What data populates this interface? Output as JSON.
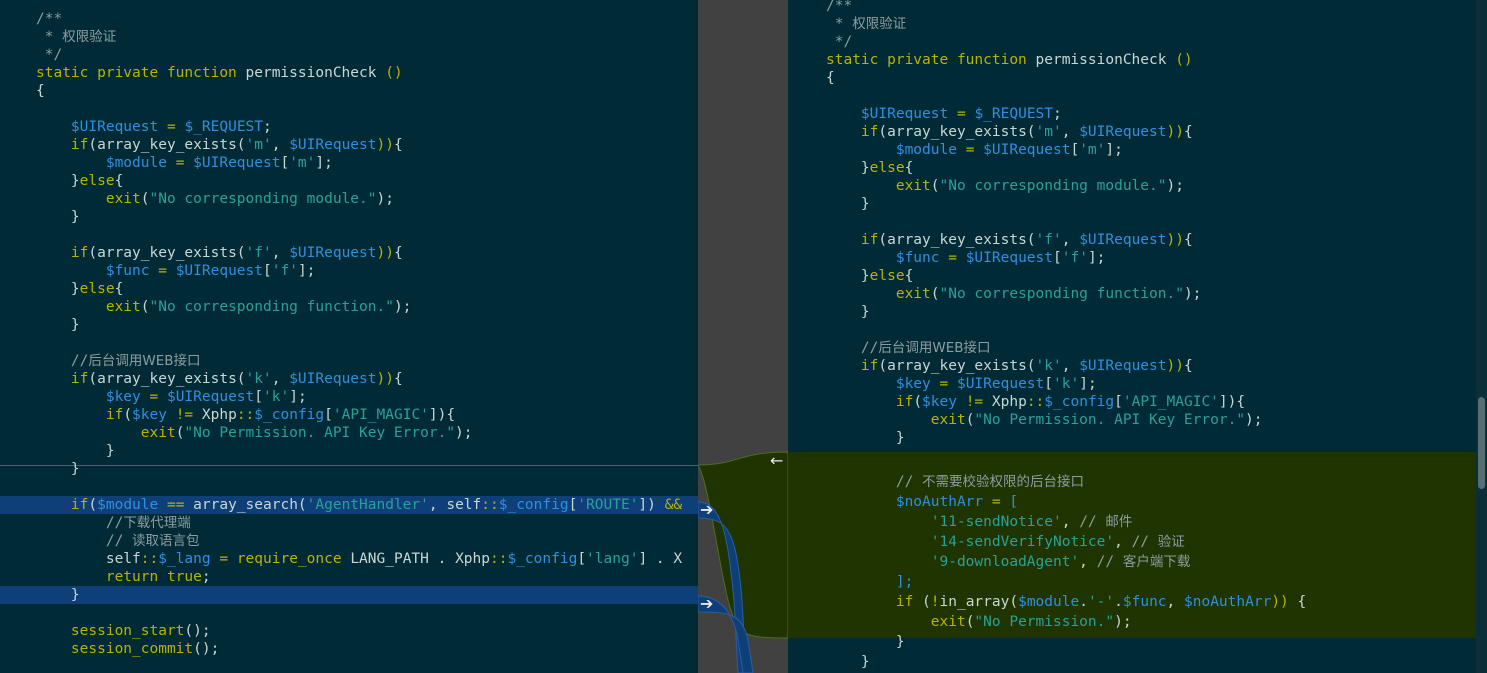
{
  "left": {
    "lines": [
      [
        [
          "cm",
          "/**"
        ]
      ],
      [
        [
          "cm",
          " * "
        ],
        [
          "cn",
          "权限验证"
        ]
      ],
      [
        [
          "cm",
          " */"
        ]
      ],
      [
        [
          "kw",
          "static private function "
        ],
        [
          "plain",
          "permissionCheck "
        ],
        [
          "kw",
          "()"
        ]
      ],
      [
        [
          "plain",
          "{"
        ]
      ],
      [],
      [
        [
          "plain",
          "    "
        ],
        [
          "var",
          "$UIRequest"
        ],
        [
          "plain",
          " "
        ],
        [
          "kw",
          "="
        ],
        [
          "plain",
          " "
        ],
        [
          "var",
          "$_REQUEST"
        ],
        [
          "plain",
          ";"
        ]
      ],
      [
        [
          "plain",
          "    "
        ],
        [
          "kw",
          "if"
        ],
        [
          "plain",
          "(array_key_exists("
        ],
        [
          "str",
          "'m'"
        ],
        [
          "plain",
          ", "
        ],
        [
          "var",
          "$UIRequest"
        ],
        [
          "kw",
          "))"
        ],
        [
          "plain",
          "{"
        ]
      ],
      [
        [
          "plain",
          "        "
        ],
        [
          "var",
          "$module"
        ],
        [
          "plain",
          " "
        ],
        [
          "kw",
          "="
        ],
        [
          "plain",
          " "
        ],
        [
          "var",
          "$UIRequest"
        ],
        [
          "plain",
          "["
        ],
        [
          "str",
          "'m'"
        ],
        [
          "plain",
          "];"
        ]
      ],
      [
        [
          "plain",
          "    }"
        ],
        [
          "kw",
          "else"
        ],
        [
          "plain",
          "{"
        ]
      ],
      [
        [
          "plain",
          "        "
        ],
        [
          "kw",
          "exit"
        ],
        [
          "plain",
          "("
        ],
        [
          "str",
          "\"No corresponding module.\""
        ],
        [
          "plain",
          ");"
        ]
      ],
      [
        [
          "plain",
          "    }"
        ]
      ],
      [],
      [
        [
          "plain",
          "    "
        ],
        [
          "kw",
          "if"
        ],
        [
          "plain",
          "(array_key_exists("
        ],
        [
          "str",
          "'f'"
        ],
        [
          "plain",
          ", "
        ],
        [
          "var",
          "$UIRequest"
        ],
        [
          "kw",
          "))"
        ],
        [
          "plain",
          "{"
        ]
      ],
      [
        [
          "plain",
          "        "
        ],
        [
          "var",
          "$func"
        ],
        [
          "plain",
          " "
        ],
        [
          "kw",
          "="
        ],
        [
          "plain",
          " "
        ],
        [
          "var",
          "$UIRequest"
        ],
        [
          "plain",
          "["
        ],
        [
          "str",
          "'f'"
        ],
        [
          "plain",
          "];"
        ]
      ],
      [
        [
          "plain",
          "    }"
        ],
        [
          "kw",
          "else"
        ],
        [
          "plain",
          "{"
        ]
      ],
      [
        [
          "plain",
          "        "
        ],
        [
          "kw",
          "exit"
        ],
        [
          "plain",
          "("
        ],
        [
          "str",
          "\"No corresponding function.\""
        ],
        [
          "plain",
          ");"
        ]
      ],
      [
        [
          "plain",
          "    }"
        ]
      ],
      [],
      [
        [
          "cm",
          "    //"
        ],
        [
          "cn",
          "后台调用WEB接口"
        ]
      ],
      [
        [
          "plain",
          "    "
        ],
        [
          "kw",
          "if"
        ],
        [
          "plain",
          "(array_key_exists("
        ],
        [
          "str",
          "'k'"
        ],
        [
          "plain",
          ", "
        ],
        [
          "var",
          "$UIRequest"
        ],
        [
          "kw",
          "))"
        ],
        [
          "plain",
          "{"
        ]
      ],
      [
        [
          "plain",
          "        "
        ],
        [
          "var",
          "$key"
        ],
        [
          "plain",
          " "
        ],
        [
          "kw",
          "="
        ],
        [
          "plain",
          " "
        ],
        [
          "var",
          "$UIRequest"
        ],
        [
          "plain",
          "["
        ],
        [
          "str",
          "'k'"
        ],
        [
          "plain",
          "];"
        ]
      ],
      [
        [
          "plain",
          "        "
        ],
        [
          "kw",
          "if"
        ],
        [
          "plain",
          "("
        ],
        [
          "var",
          "$key"
        ],
        [
          "plain",
          " "
        ],
        [
          "kw",
          "!="
        ],
        [
          "plain",
          " Xphp"
        ],
        [
          "kw",
          "::"
        ],
        [
          "var",
          "$_config"
        ],
        [
          "plain",
          "["
        ],
        [
          "str",
          "'API_MAGIC'"
        ],
        [
          "plain",
          "]){"
        ]
      ],
      [
        [
          "plain",
          "            "
        ],
        [
          "kw",
          "exit"
        ],
        [
          "plain",
          "("
        ],
        [
          "str",
          "\"No Permission. API Key Error.\""
        ],
        [
          "plain",
          ");"
        ]
      ],
      [
        [
          "plain",
          "        }"
        ]
      ],
      [
        [
          "plain",
          "    }"
        ]
      ],
      [],
      [
        [
          "plain",
          "    "
        ],
        [
          "kw",
          "if"
        ],
        [
          "plain",
          "("
        ],
        [
          "var",
          "$module"
        ],
        [
          "plain",
          " "
        ],
        [
          "kw",
          "=="
        ],
        [
          "plain",
          " array_search("
        ],
        [
          "str",
          "'AgentHandler'"
        ],
        [
          "plain",
          ", self"
        ],
        [
          "kw",
          "::"
        ],
        [
          "var",
          "$_config"
        ],
        [
          "plain",
          "["
        ],
        [
          "str",
          "'ROUTE'"
        ],
        [
          "plain",
          "]) "
        ],
        [
          "kw",
          "&&"
        ]
      ],
      [
        [
          "cm",
          "        //"
        ],
        [
          "cn",
          "下载代理端"
        ]
      ],
      [
        [
          "cm",
          "        // "
        ],
        [
          "cn",
          "读取语言包"
        ]
      ],
      [
        [
          "plain",
          "        self"
        ],
        [
          "kw",
          "::"
        ],
        [
          "var",
          "$_lang"
        ],
        [
          "plain",
          " "
        ],
        [
          "kw",
          "="
        ],
        [
          "plain",
          " "
        ],
        [
          "kw",
          "require_once"
        ],
        [
          "plain",
          " LANG_PATH . Xphp"
        ],
        [
          "kw",
          "::"
        ],
        [
          "var",
          "$_config"
        ],
        [
          "plain",
          "["
        ],
        [
          "str",
          "'lang'"
        ],
        [
          "plain",
          "] . X"
        ]
      ],
      [
        [
          "plain",
          "        "
        ],
        [
          "kw",
          "return true"
        ],
        [
          "plain",
          ";"
        ]
      ],
      [
        [
          "plain",
          "    }"
        ]
      ],
      [],
      [
        [
          "plain",
          "    "
        ],
        [
          "kw",
          "session_start"
        ],
        [
          "plain",
          "();"
        ]
      ],
      [
        [
          "plain",
          "    "
        ],
        [
          "kw",
          "session_commit"
        ],
        [
          "plain",
          "();"
        ]
      ]
    ]
  },
  "right": {
    "lines": [
      [
        [
          "cm",
          "/**"
        ]
      ],
      [
        [
          "cm",
          " * "
        ],
        [
          "cn",
          "权限验证"
        ]
      ],
      [
        [
          "cm",
          " */"
        ]
      ],
      [
        [
          "kw",
          "static private function "
        ],
        [
          "plain",
          "permissionCheck "
        ],
        [
          "kw",
          "()"
        ]
      ],
      [
        [
          "plain",
          "{"
        ]
      ],
      [],
      [
        [
          "plain",
          "    "
        ],
        [
          "var",
          "$UIRequest"
        ],
        [
          "plain",
          " "
        ],
        [
          "kw",
          "="
        ],
        [
          "plain",
          " "
        ],
        [
          "var",
          "$_REQUEST"
        ],
        [
          "plain",
          ";"
        ]
      ],
      [
        [
          "plain",
          "    "
        ],
        [
          "kw",
          "if"
        ],
        [
          "plain",
          "(array_key_exists("
        ],
        [
          "str",
          "'m'"
        ],
        [
          "plain",
          ", "
        ],
        [
          "var",
          "$UIRequest"
        ],
        [
          "kw",
          "))"
        ],
        [
          "plain",
          "{"
        ]
      ],
      [
        [
          "plain",
          "        "
        ],
        [
          "var",
          "$module"
        ],
        [
          "plain",
          " "
        ],
        [
          "kw",
          "="
        ],
        [
          "plain",
          " "
        ],
        [
          "var",
          "$UIRequest"
        ],
        [
          "plain",
          "["
        ],
        [
          "str",
          "'m'"
        ],
        [
          "plain",
          "];"
        ]
      ],
      [
        [
          "plain",
          "    }"
        ],
        [
          "kw",
          "else"
        ],
        [
          "plain",
          "{"
        ]
      ],
      [
        [
          "plain",
          "        "
        ],
        [
          "kw",
          "exit"
        ],
        [
          "plain",
          "("
        ],
        [
          "str",
          "\"No corresponding module.\""
        ],
        [
          "plain",
          ");"
        ]
      ],
      [
        [
          "plain",
          "    }"
        ]
      ],
      [],
      [
        [
          "plain",
          "    "
        ],
        [
          "kw",
          "if"
        ],
        [
          "plain",
          "(array_key_exists("
        ],
        [
          "str",
          "'f'"
        ],
        [
          "plain",
          ", "
        ],
        [
          "var",
          "$UIRequest"
        ],
        [
          "kw",
          "))"
        ],
        [
          "plain",
          "{"
        ]
      ],
      [
        [
          "plain",
          "        "
        ],
        [
          "var",
          "$func"
        ],
        [
          "plain",
          " "
        ],
        [
          "kw",
          "="
        ],
        [
          "plain",
          " "
        ],
        [
          "var",
          "$UIRequest"
        ],
        [
          "plain",
          "["
        ],
        [
          "str",
          "'f'"
        ],
        [
          "plain",
          "];"
        ]
      ],
      [
        [
          "plain",
          "    }"
        ],
        [
          "kw",
          "else"
        ],
        [
          "plain",
          "{"
        ]
      ],
      [
        [
          "plain",
          "        "
        ],
        [
          "kw",
          "exit"
        ],
        [
          "plain",
          "("
        ],
        [
          "str",
          "\"No corresponding function.\""
        ],
        [
          "plain",
          ");"
        ]
      ],
      [
        [
          "plain",
          "    }"
        ]
      ],
      [],
      [
        [
          "cm",
          "    //"
        ],
        [
          "cn",
          "后台调用WEB接口"
        ]
      ],
      [
        [
          "plain",
          "    "
        ],
        [
          "kw",
          "if"
        ],
        [
          "plain",
          "(array_key_exists("
        ],
        [
          "str",
          "'k'"
        ],
        [
          "plain",
          ", "
        ],
        [
          "var",
          "$UIRequest"
        ],
        [
          "kw",
          "))"
        ],
        [
          "plain",
          "{"
        ]
      ],
      [
        [
          "plain",
          "        "
        ],
        [
          "var",
          "$key"
        ],
        [
          "plain",
          " "
        ],
        [
          "kw",
          "="
        ],
        [
          "plain",
          " "
        ],
        [
          "var",
          "$UIRequest"
        ],
        [
          "plain",
          "["
        ],
        [
          "str",
          "'k'"
        ],
        [
          "plain",
          "];"
        ]
      ],
      [
        [
          "plain",
          "        "
        ],
        [
          "kw",
          "if"
        ],
        [
          "plain",
          "("
        ],
        [
          "var",
          "$key"
        ],
        [
          "plain",
          " "
        ],
        [
          "kw",
          "!="
        ],
        [
          "plain",
          " Xphp"
        ],
        [
          "kw",
          "::"
        ],
        [
          "var",
          "$_config"
        ],
        [
          "plain",
          "["
        ],
        [
          "str",
          "'API_MAGIC'"
        ],
        [
          "plain",
          "]){"
        ]
      ],
      [
        [
          "plain",
          "            "
        ],
        [
          "kw",
          "exit"
        ],
        [
          "plain",
          "("
        ],
        [
          "str",
          "\"No Permission. API Key Error.\""
        ],
        [
          "plain",
          ");"
        ]
      ],
      [
        [
          "plain",
          "        }"
        ]
      ],
      [],
      [
        [
          "cm",
          "        // "
        ],
        [
          "cn",
          "不需要校验权限的后台接口"
        ]
      ],
      [
        [
          "plain",
          "        "
        ],
        [
          "var",
          "$noAuthArr"
        ],
        [
          "plain",
          " "
        ],
        [
          "kw",
          "="
        ],
        [
          "plain",
          " "
        ],
        [
          "var",
          "["
        ]
      ],
      [
        [
          "plain",
          "            "
        ],
        [
          "str",
          "'11-sendNotice'"
        ],
        [
          "plain",
          ", "
        ],
        [
          "cm",
          "// "
        ],
        [
          "cn",
          "邮件"
        ]
      ],
      [
        [
          "plain",
          "            "
        ],
        [
          "str",
          "'14-sendVerifyNotice'"
        ],
        [
          "plain",
          ", "
        ],
        [
          "cm",
          "// "
        ],
        [
          "cn",
          "验证"
        ]
      ],
      [
        [
          "plain",
          "            "
        ],
        [
          "str",
          "'9-downloadAgent'"
        ],
        [
          "plain",
          ", "
        ],
        [
          "cm",
          "// "
        ],
        [
          "cn",
          "客户端下载"
        ]
      ],
      [
        [
          "plain",
          "        "
        ],
        [
          "var",
          "];"
        ]
      ],
      [
        [
          "plain",
          "        "
        ],
        [
          "kw",
          "if"
        ],
        [
          "plain",
          " ("
        ],
        [
          "kw",
          "!"
        ],
        [
          "plain",
          "in_array("
        ],
        [
          "var",
          "$module"
        ],
        [
          "plain",
          "."
        ],
        [
          "str",
          "'-'"
        ],
        [
          "plain",
          "."
        ],
        [
          "var",
          "$func"
        ],
        [
          "plain",
          ", "
        ],
        [
          "var",
          "$noAuthArr"
        ],
        [
          "kw",
          "))"
        ],
        [
          "plain",
          " {"
        ]
      ],
      [
        [
          "plain",
          "            "
        ],
        [
          "kw",
          "exit"
        ],
        [
          "plain",
          "("
        ],
        [
          "str",
          "\"No Permission.\""
        ],
        [
          "plain",
          ");"
        ]
      ],
      [
        [
          "plain",
          "        }"
        ]
      ],
      [
        [
          "plain",
          "    }"
        ]
      ]
    ]
  },
  "colors": {
    "background": "#002b36",
    "gutter": "#414141",
    "change_highlight": "#0e3f78",
    "insert_highlight": "#1f3400"
  },
  "icons": [
    "arrow-left-icon",
    "arrow-right-icon"
  ]
}
